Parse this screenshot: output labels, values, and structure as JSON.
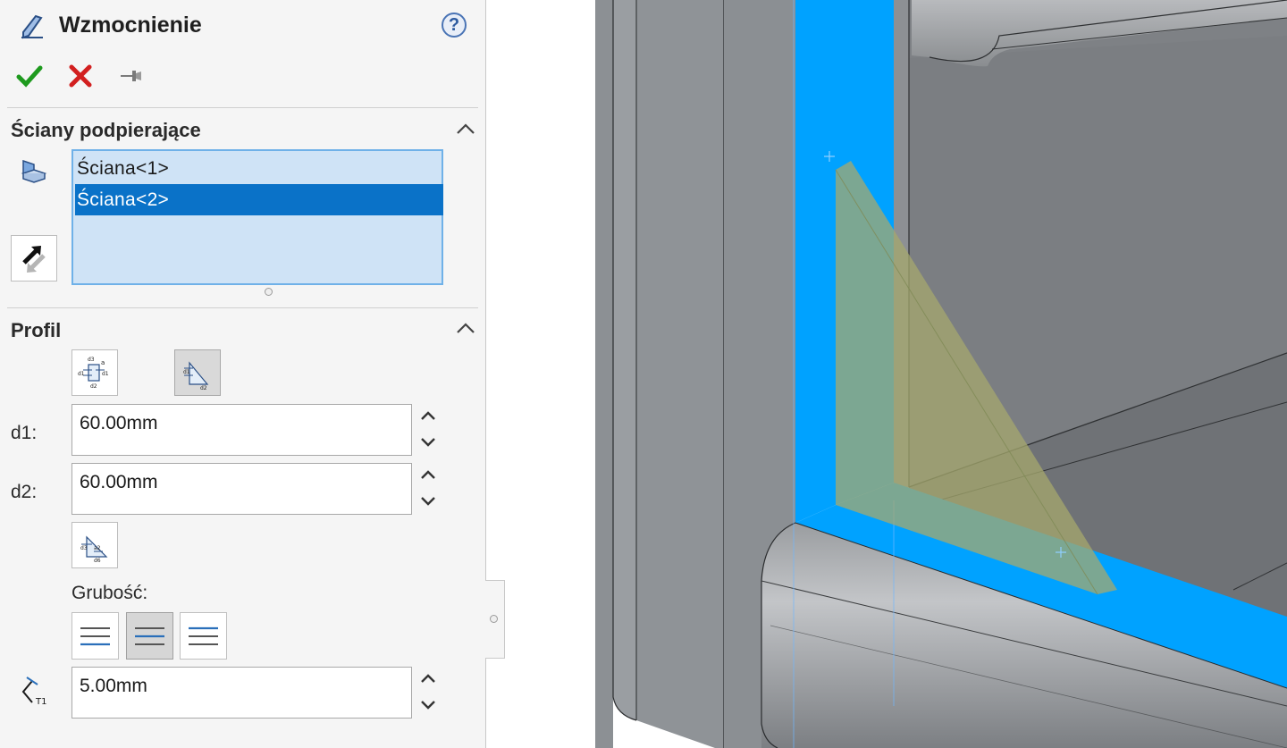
{
  "header": {
    "title": "Wzmocnienie",
    "help_label": "?",
    "ok_icon": "checkmark-icon",
    "cancel_icon": "close-icon",
    "pin_icon": "pushpin-icon"
  },
  "supporting_faces": {
    "section_title": "Ściany podpierające",
    "items": [
      {
        "label": "Ściana<1>",
        "selected": false
      },
      {
        "label": "Ściana<2>",
        "selected": true
      }
    ],
    "face_icon": "face-selection-icon",
    "reverse_icon": "reverse-direction-icon"
  },
  "profile": {
    "section_title": "Profil",
    "profile_type_buttons": [
      "profile-type-1-icon",
      "profile-type-2-icon"
    ],
    "d1_label": "d1:",
    "d1_value": "60.00mm",
    "d2_label": "d2:",
    "d2_value": "60.00mm",
    "chamfer_icon": "profile-chamfer-icon",
    "thickness_label": "Grubość:",
    "thickness_options": [
      "thickness-left-icon",
      "thickness-center-icon",
      "thickness-right-icon"
    ],
    "thickness_selected": 1,
    "thickness_value": "5.00mm",
    "thickness_icon": "thickness-t1-icon"
  },
  "colors": {
    "selection_blue": "#00a2ff",
    "list_bg": "#cfe3f6",
    "list_selected": "#0a72c8",
    "ok_green": "#1e9a1e",
    "cancel_red": "#d21f1f",
    "rib_preview": "#a6a86e"
  }
}
